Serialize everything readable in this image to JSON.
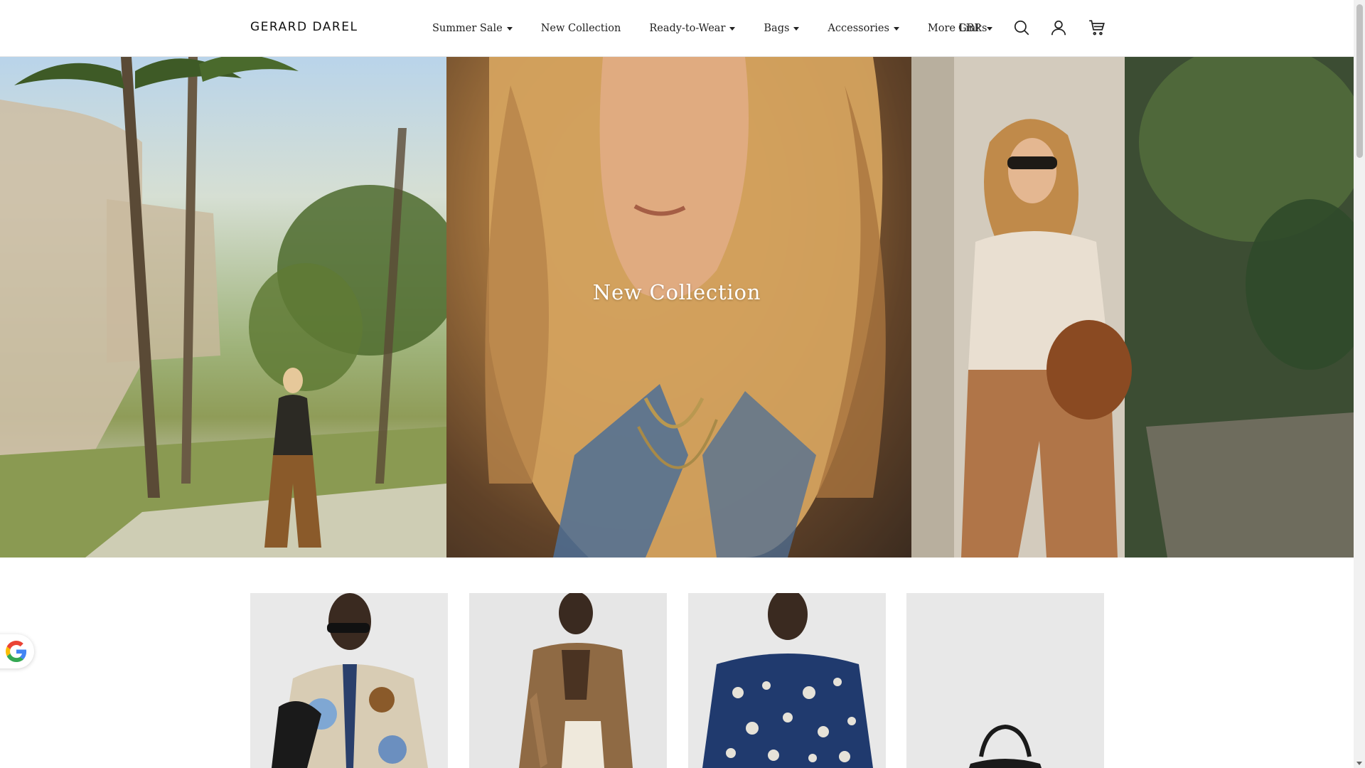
{
  "brand": {
    "logo_text": "GERARD DAREL"
  },
  "nav": {
    "items": [
      {
        "label": "Summer Sale",
        "dropdown": true
      },
      {
        "label": "New Collection",
        "dropdown": false
      },
      {
        "label": "Ready-to-Wear",
        "dropdown": true
      },
      {
        "label": "Bags",
        "dropdown": true
      },
      {
        "label": "Accessories",
        "dropdown": true
      },
      {
        "label": "More Links",
        "dropdown": false
      }
    ]
  },
  "header": {
    "currency": "GBP",
    "icons": [
      "search-icon",
      "account-icon",
      "cart-icon"
    ]
  },
  "hero": {
    "title": "New Collection"
  },
  "products": {
    "count_visible": 4
  },
  "widgets": {
    "google_badge_icon": "google-icon"
  },
  "colors": {
    "header_bg": "#ffffff",
    "text": "#222222",
    "hero_title": "#ffffff",
    "card_bg": "#ececec"
  }
}
